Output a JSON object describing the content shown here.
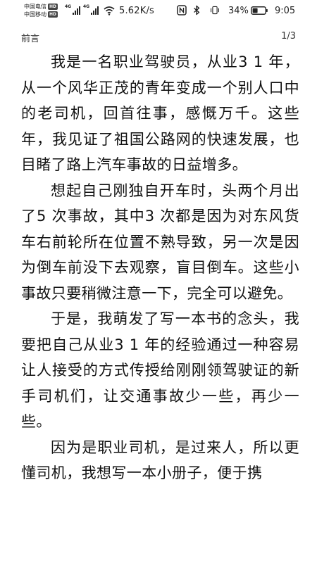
{
  "status_bar": {
    "carrier1": "中国电信",
    "carrier1_badge": "HD",
    "carrier2": "中国移动",
    "carrier2_badge": "HD",
    "net1": "4G",
    "net2": "4G",
    "net_speed": "5.62K/s",
    "battery": "34%",
    "time": "9:05",
    "icons": [
      "signal-icon",
      "wifi-icon",
      "nfc-icon",
      "bluetooth-icon",
      "vibrate-icon",
      "battery-icon"
    ]
  },
  "reader": {
    "chapter_title": "前言",
    "page_indicator": "1/3",
    "paragraphs": [
      "我是一名职业驾驶员，从业3 1 年，从一个风华正茂的青年变成一个别人口中的老司机，回首往事，感慨万千。这些年，我见证了祖国公路网的快速发展，也目睹了路上汽车事故的日益增多。",
      "想起自己刚独自开车时，头两个月出了5 次事故，其中3 次都是因为对东风货车右前轮所在位置不熟导致，另一次是因为倒车前没下去观察，盲目倒车。这些小事故只要稍微注意一下，完全可以避免。",
      "于是，我萌发了写一本书的念头，我要把自己从业3 1 年的经验通过一种容易让人接受的方式传授给刚刚领驾驶证的新手司机们，让交通事故少一些，再少一些。",
      "因为是职业司机，是过来人，所以更懂司机，我想写一本小册子，便于携"
    ]
  }
}
